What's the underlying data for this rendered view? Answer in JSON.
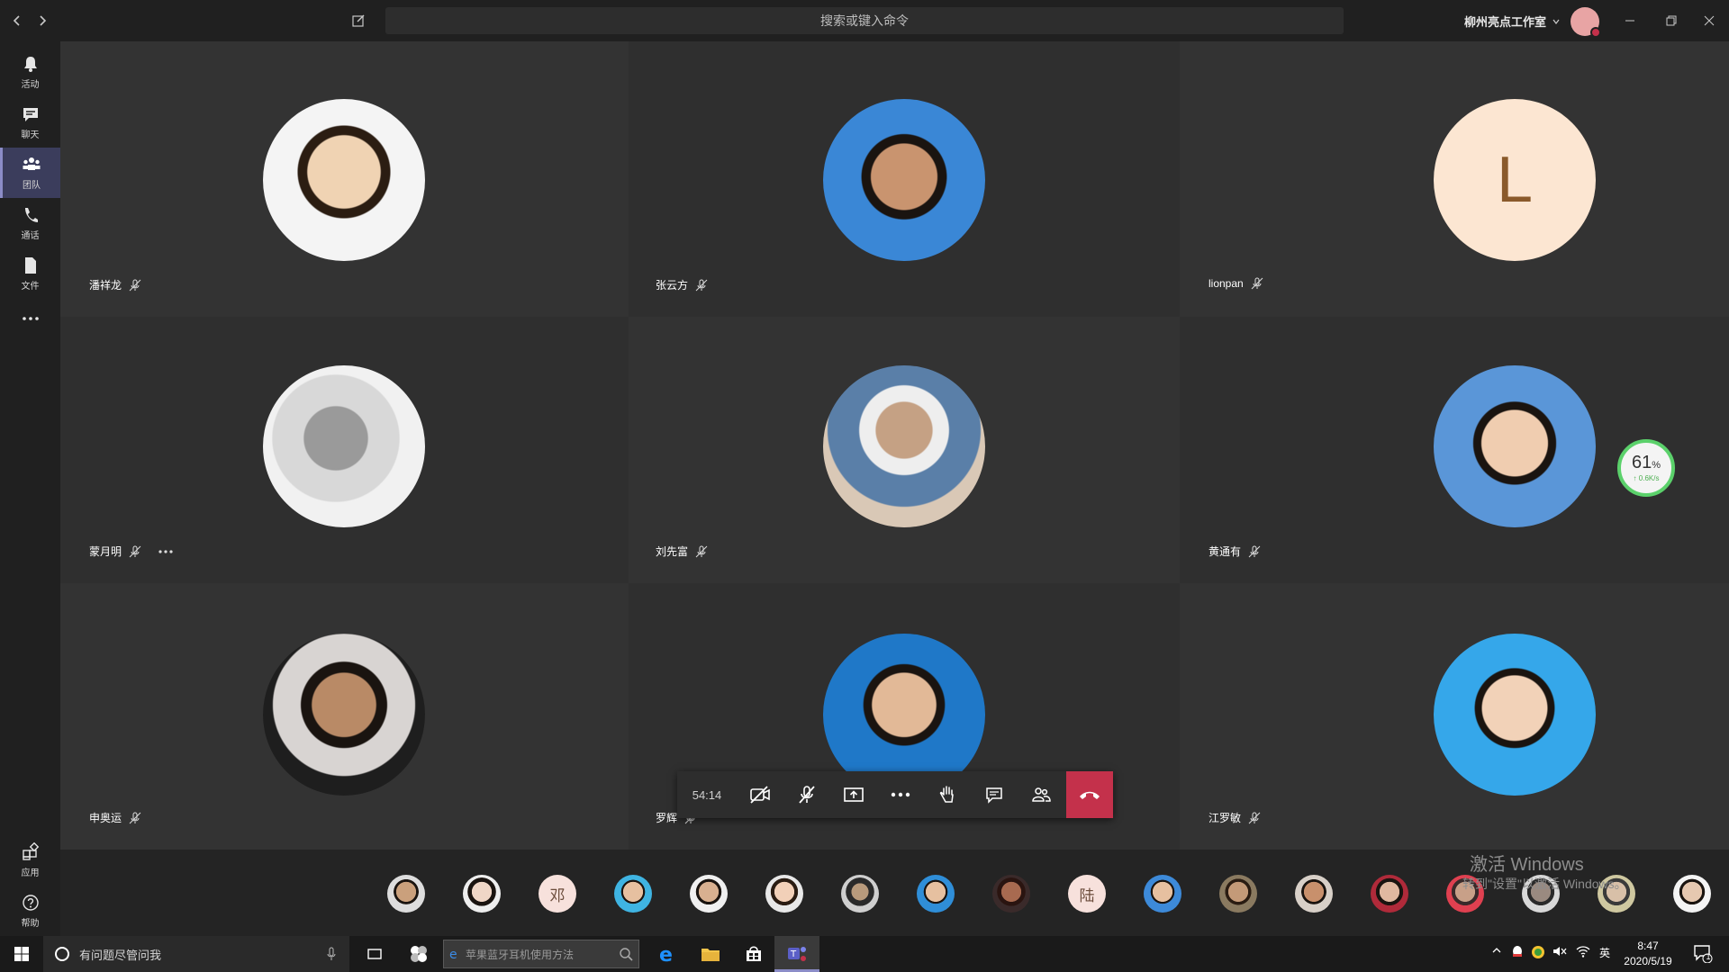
{
  "titlebar": {
    "search_placeholder": "搜索或键入命令",
    "org_name": "柳州亮点工作室"
  },
  "rail": [
    {
      "label": "活动",
      "icon": "bell-icon"
    },
    {
      "label": "聊天",
      "icon": "chat-icon"
    },
    {
      "label": "团队",
      "icon": "teams-icon",
      "active": true
    },
    {
      "label": "通话",
      "icon": "phone-icon"
    },
    {
      "label": "文件",
      "icon": "file-icon"
    }
  ],
  "rail_bottom": [
    {
      "label": "应用",
      "icon": "apps-icon"
    },
    {
      "label": "帮助",
      "icon": "help-icon"
    }
  ],
  "participants": [
    {
      "name": "潘祥龙",
      "avatar": "photo"
    },
    {
      "name": "张云方",
      "avatar": "photo"
    },
    {
      "name": "lionpan",
      "avatar": "letter",
      "letter": "L"
    },
    {
      "name": "蒙月明",
      "avatar": "photo",
      "has_more": true
    },
    {
      "name": "刘先富",
      "avatar": "photo"
    },
    {
      "name": "黄通有",
      "avatar": "photo"
    },
    {
      "name": "申奥运",
      "avatar": "photo"
    },
    {
      "name": "罗辉",
      "avatar": "photo"
    },
    {
      "name": "江罗敏",
      "avatar": "photo"
    }
  ],
  "call": {
    "timer": "54:14",
    "controls": [
      "camera-off-icon",
      "mic-off-icon",
      "share-screen-icon",
      "more-icon",
      "raise-hand-icon",
      "chat-icon",
      "people-icon"
    ],
    "hangup_icon": "hangup-icon"
  },
  "strip_thumbs": [
    {
      "type": "photo"
    },
    {
      "type": "photo"
    },
    {
      "type": "letter",
      "letter": "邓"
    },
    {
      "type": "photo"
    },
    {
      "type": "photo"
    },
    {
      "type": "photo"
    },
    {
      "type": "photo"
    },
    {
      "type": "photo"
    },
    {
      "type": "photo"
    },
    {
      "type": "letter",
      "letter": "陆"
    },
    {
      "type": "photo"
    },
    {
      "type": "photo"
    },
    {
      "type": "photo"
    },
    {
      "type": "photo"
    },
    {
      "type": "photo"
    },
    {
      "type": "photo"
    },
    {
      "type": "photo"
    },
    {
      "type": "photo"
    }
  ],
  "watermark": {
    "line1": "激活 Windows",
    "line2": "转到\"设置\"以激活 Windows。"
  },
  "net_widget": {
    "percent": "61",
    "unit": "%",
    "speed": "↑ 0.6K/s"
  },
  "taskbar": {
    "cortana_placeholder": "有问题尽管问我",
    "search_text": "苹果蓝牙耳机使用方法",
    "tray_lang": "英",
    "time": "8:47",
    "date": "2020/5/19",
    "notification_count": "1"
  },
  "colors": {
    "accent": "#8b8cc7",
    "hangup": "#c4314b",
    "tile_bg": "#333333"
  }
}
